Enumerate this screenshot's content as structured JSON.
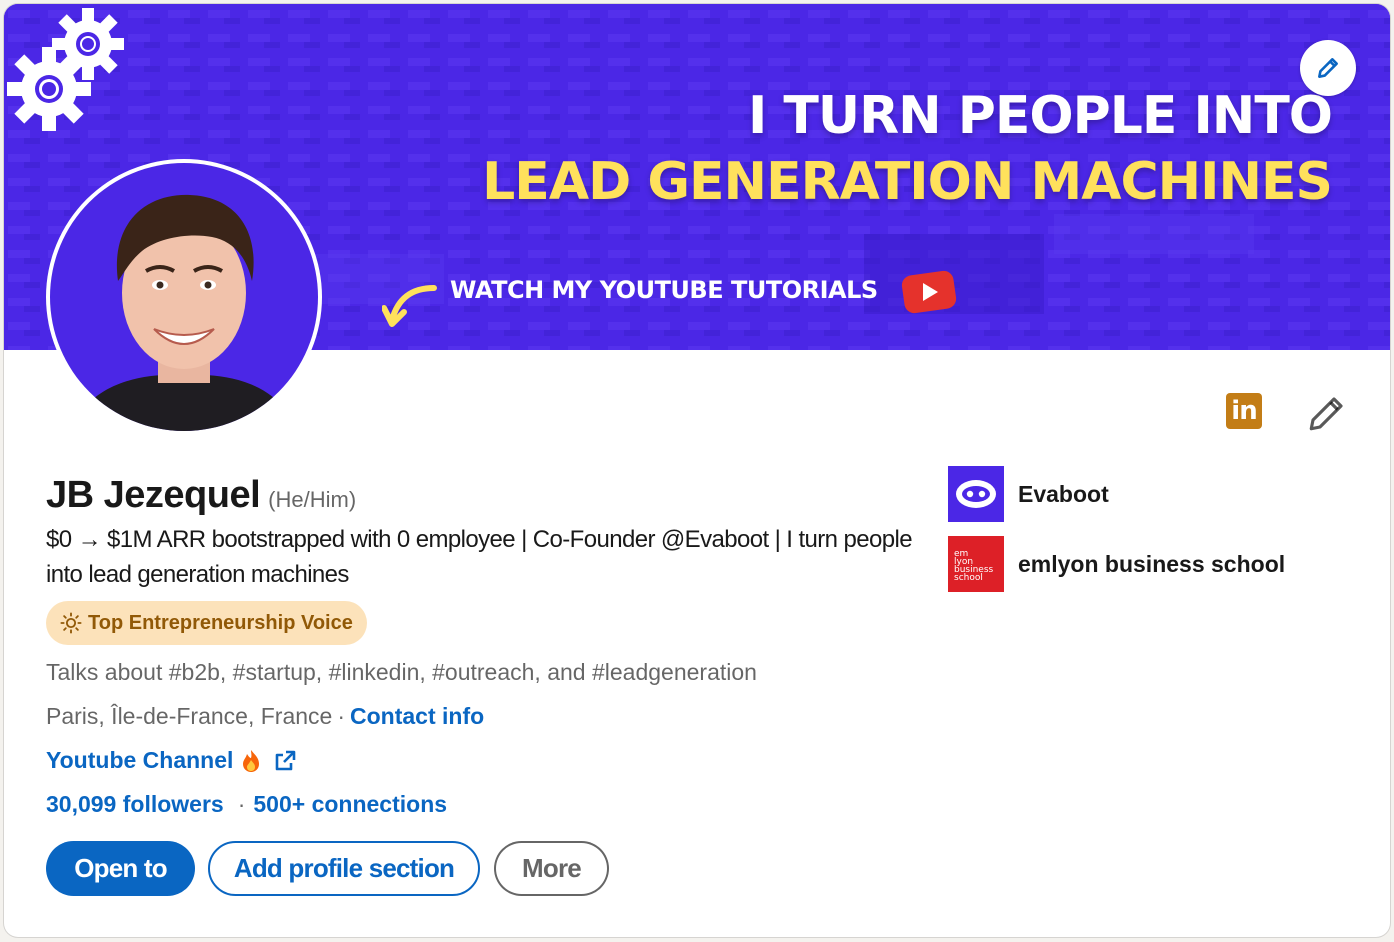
{
  "banner": {
    "line1": "I TURN PEOPLE INTO",
    "line2": "LEAD GENERATION MACHINES",
    "cta": "WATCH MY YOUTUBE TUTORIALS",
    "edit_icon": "pencil-icon"
  },
  "profile": {
    "name": "JB Jezequel",
    "pronouns": "(He/Him)",
    "headline": "$0 → $1M ARR bootstrapped with 0 employee | Co-Founder @Evaboot | I turn people into lead generation machines",
    "badge": "Top Entrepreneurship Voice",
    "talks_about": "Talks about #b2b, #startup, #linkedin, #outreach, and #leadgeneration",
    "location": "Paris, Île-de-France, France",
    "separator": "·",
    "contact_info": "Contact info",
    "website_label": "Youtube Channel",
    "followers": "30,099 followers",
    "connections": "500+ connections"
  },
  "actions": {
    "open_to": "Open to",
    "add_section": "Add profile section",
    "more": "More"
  },
  "organizations": [
    {
      "name": "Evaboot"
    },
    {
      "name": "emlyon business school",
      "logo_text": [
        "em",
        "lyon",
        "business",
        "school"
      ]
    }
  ],
  "top_icons": {
    "linkedin_badge": "in",
    "edit": "pencil-icon"
  },
  "colors": {
    "banner": "#4b27e6",
    "accent": "#0a66c2",
    "badge_bg": "#fce2ba",
    "badge_text": "#915907",
    "banner_yellow": "#ffe15c"
  }
}
